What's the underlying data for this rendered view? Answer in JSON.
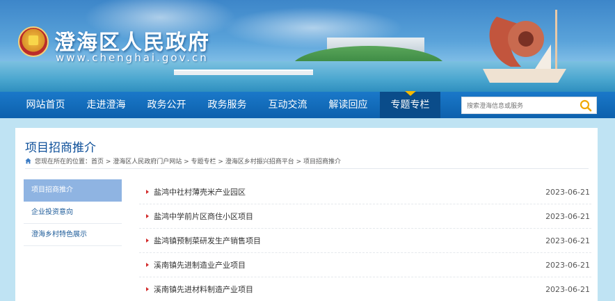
{
  "header": {
    "site_title": "澄海区人民政府",
    "site_domain": "www.chenghai.gov.cn"
  },
  "nav": {
    "items": [
      {
        "label": "网站首页"
      },
      {
        "label": "走进澄海"
      },
      {
        "label": "政务公开"
      },
      {
        "label": "政务服务"
      },
      {
        "label": "互动交流"
      },
      {
        "label": "解读回应"
      },
      {
        "label": "专题专栏",
        "active": true
      }
    ],
    "search_placeholder": "搜索澄海信息或服务"
  },
  "page": {
    "title": "项目招商推介",
    "breadcrumb": "您现在所在的位置：首页 > 澄海区人民政府门户网站 > 专题专栏 > 澄海区乡村振兴招商平台 > 项目招商推介"
  },
  "sidebar": {
    "items": [
      {
        "label": "项目招商推介",
        "active": true
      },
      {
        "label": "企业投资意向"
      },
      {
        "label": "澄海乡村特色展示"
      }
    ]
  },
  "articles": [
    {
      "title": "盐鸿中社村薄壳米产业园区",
      "date": "2023-06-21"
    },
    {
      "title": "盐鸿中学前片区商住小区项目",
      "date": "2023-06-21"
    },
    {
      "title": "盐鸿镇预制菜研发生产销售项目",
      "date": "2023-06-21"
    },
    {
      "title": "溪南镇先进制造业产业项目",
      "date": "2023-06-21"
    },
    {
      "title": "溪南镇先进材料制造产业项目",
      "date": "2023-06-21"
    }
  ],
  "colors": {
    "nav_bg": "#0d61ad",
    "nav_active": "#0a4c8a",
    "title_blue": "#0d4f99",
    "sidebar_active": "#8fb4e2",
    "bullet_red": "#d22a2a"
  }
}
